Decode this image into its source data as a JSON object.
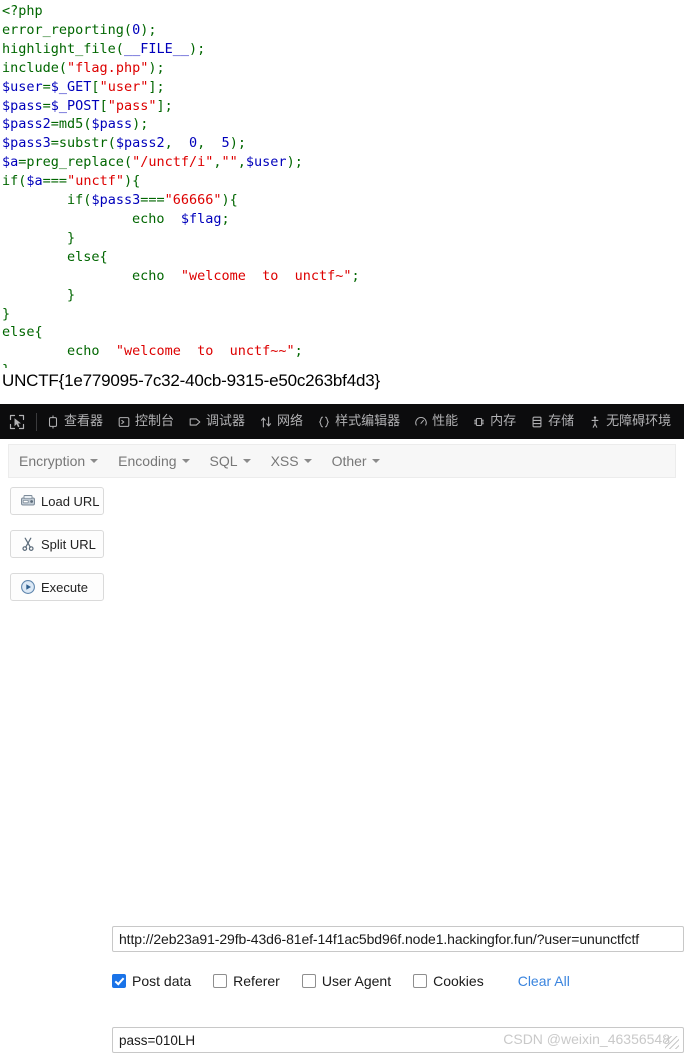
{
  "php_source": {
    "lines": [
      [
        {
          "t": "<?php",
          "c": "g"
        }
      ],
      [
        {
          "t": "error_reporting",
          "c": "g"
        },
        {
          "t": "(",
          "c": "g"
        },
        {
          "t": "0",
          "c": "k"
        },
        {
          "t": ");",
          "c": "g"
        }
      ],
      [
        {
          "t": "highlight_file",
          "c": "g"
        },
        {
          "t": "(",
          "c": "g"
        },
        {
          "t": "__FILE__",
          "c": "k"
        },
        {
          "t": ");",
          "c": "g"
        }
      ],
      [
        {
          "t": "include",
          "c": "g"
        },
        {
          "t": "(",
          "c": "g"
        },
        {
          "t": "\"flag.php\"",
          "c": "s"
        },
        {
          "t": ");",
          "c": "g"
        }
      ],
      [
        {
          "t": "$user",
          "c": "k"
        },
        {
          "t": "=",
          "c": "g"
        },
        {
          "t": "$_GET",
          "c": "k"
        },
        {
          "t": "[",
          "c": "g"
        },
        {
          "t": "\"user\"",
          "c": "s"
        },
        {
          "t": "];",
          "c": "g"
        }
      ],
      [
        {
          "t": "$pass",
          "c": "k"
        },
        {
          "t": "=",
          "c": "g"
        },
        {
          "t": "$_POST",
          "c": "k"
        },
        {
          "t": "[",
          "c": "g"
        },
        {
          "t": "\"pass\"",
          "c": "s"
        },
        {
          "t": "];",
          "c": "g"
        }
      ],
      [
        {
          "t": "$pass2",
          "c": "k"
        },
        {
          "t": "=",
          "c": "g"
        },
        {
          "t": "md5",
          "c": "g"
        },
        {
          "t": "(",
          "c": "g"
        },
        {
          "t": "$pass",
          "c": "k"
        },
        {
          "t": ");",
          "c": "g"
        }
      ],
      [
        {
          "t": "$pass3",
          "c": "k"
        },
        {
          "t": "=",
          "c": "g"
        },
        {
          "t": "substr",
          "c": "g"
        },
        {
          "t": "(",
          "c": "g"
        },
        {
          "t": "$pass2",
          "c": "k"
        },
        {
          "t": ",  ",
          "c": "g"
        },
        {
          "t": "0",
          "c": "k"
        },
        {
          "t": ",  ",
          "c": "g"
        },
        {
          "t": "5",
          "c": "k"
        },
        {
          "t": ");",
          "c": "g"
        }
      ],
      [
        {
          "t": "$a",
          "c": "k"
        },
        {
          "t": "=",
          "c": "g"
        },
        {
          "t": "preg_replace",
          "c": "g"
        },
        {
          "t": "(",
          "c": "g"
        },
        {
          "t": "\"/unctf/i\"",
          "c": "s"
        },
        {
          "t": ",",
          "c": "g"
        },
        {
          "t": "\"\"",
          "c": "s"
        },
        {
          "t": ",",
          "c": "g"
        },
        {
          "t": "$user",
          "c": "k"
        },
        {
          "t": ");",
          "c": "g"
        }
      ],
      [
        {
          "t": "if",
          "c": "g"
        },
        {
          "t": "(",
          "c": "g"
        },
        {
          "t": "$a",
          "c": "k"
        },
        {
          "t": "===",
          "c": "g"
        },
        {
          "t": "\"unctf\"",
          "c": "s"
        },
        {
          "t": "){",
          "c": "g"
        }
      ],
      [
        {
          "t": "        ",
          "c": "g"
        },
        {
          "t": "if",
          "c": "g"
        },
        {
          "t": "(",
          "c": "g"
        },
        {
          "t": "$pass3",
          "c": "k"
        },
        {
          "t": "===",
          "c": "g"
        },
        {
          "t": "\"66666\"",
          "c": "s"
        },
        {
          "t": "){",
          "c": "g"
        }
      ],
      [
        {
          "t": "                ",
          "c": "g"
        },
        {
          "t": "echo",
          "c": "g"
        },
        {
          "t": "  ",
          "c": "g"
        },
        {
          "t": "$flag",
          "c": "k"
        },
        {
          "t": ";",
          "c": "g"
        }
      ],
      [
        {
          "t": "        }",
          "c": "g"
        }
      ],
      [
        {
          "t": "        else{",
          "c": "g"
        }
      ],
      [
        {
          "t": "                ",
          "c": "g"
        },
        {
          "t": "echo",
          "c": "g"
        },
        {
          "t": "  ",
          "c": "g"
        },
        {
          "t": "\"welcome  to  unctf~\"",
          "c": "s"
        },
        {
          "t": ";",
          "c": "g"
        }
      ],
      [
        {
          "t": "        }",
          "c": "g"
        }
      ],
      [
        {
          "t": "}",
          "c": "g"
        }
      ],
      [
        {
          "t": "else{",
          "c": "g"
        }
      ],
      [
        {
          "t": "        ",
          "c": "g"
        },
        {
          "t": "echo",
          "c": "g"
        },
        {
          "t": "  ",
          "c": "g"
        },
        {
          "t": "\"welcome  to  unctf~~\"",
          "c": "s"
        },
        {
          "t": ";",
          "c": "g"
        }
      ],
      [
        {
          "t": "}",
          "c": "g"
        }
      ]
    ],
    "colors": {
      "default": "#006600",
      "string": "#DD0000",
      "keyword": "#0000BB",
      "background": "#FFFFFF"
    }
  },
  "flag_output": {
    "text": "UNCTF{1e779095-7c32-40cb-9315-e50c263bf4d3}"
  },
  "devtools": {
    "background": "#0c0c0d",
    "text_color": "#b1b1b3",
    "picker_icon": "element-picker-icon",
    "tabs": [
      {
        "label": "查看器",
        "icon": "inspector-icon"
      },
      {
        "label": "控制台",
        "icon": "console-icon"
      },
      {
        "label": "调试器",
        "icon": "debugger-icon"
      },
      {
        "label": "网络",
        "icon": "network-icon"
      },
      {
        "label": "样式编辑器",
        "icon": "style-editor-icon"
      },
      {
        "label": "性能",
        "icon": "performance-icon"
      },
      {
        "label": "内存",
        "icon": "memory-icon"
      },
      {
        "label": "存储",
        "icon": "storage-icon"
      },
      {
        "label": "无障碍环境",
        "icon": "accessibility-icon"
      }
    ]
  },
  "hackbar": {
    "menus": [
      {
        "label": "Encryption"
      },
      {
        "label": "Encoding"
      },
      {
        "label": "SQL"
      },
      {
        "label": "XSS"
      },
      {
        "label": "Other"
      }
    ],
    "buttons": [
      {
        "label": "Load URL",
        "icon": "load-url-icon"
      },
      {
        "label": "Split URL",
        "icon": "scissors-icon"
      },
      {
        "label": "Execute",
        "icon": "play-icon"
      }
    ],
    "url": {
      "value": "http://2eb23a91-29fb-43d6-81ef-14f1ac5bd96f.node1.hackingfor.fun/?user=ununctfctf",
      "placeholder": ""
    },
    "options": [
      {
        "label": "Post data",
        "checked": true
      },
      {
        "label": "Referer",
        "checked": false
      },
      {
        "label": "User Agent",
        "checked": false
      },
      {
        "label": "Cookies",
        "checked": false
      }
    ],
    "clear_all_label": "Clear All",
    "clear_all_color": "#3a84de",
    "post_data": {
      "value": "pass=010LH",
      "placeholder": ""
    }
  },
  "watermark": {
    "text": "CSDN @weixin_46356548"
  }
}
